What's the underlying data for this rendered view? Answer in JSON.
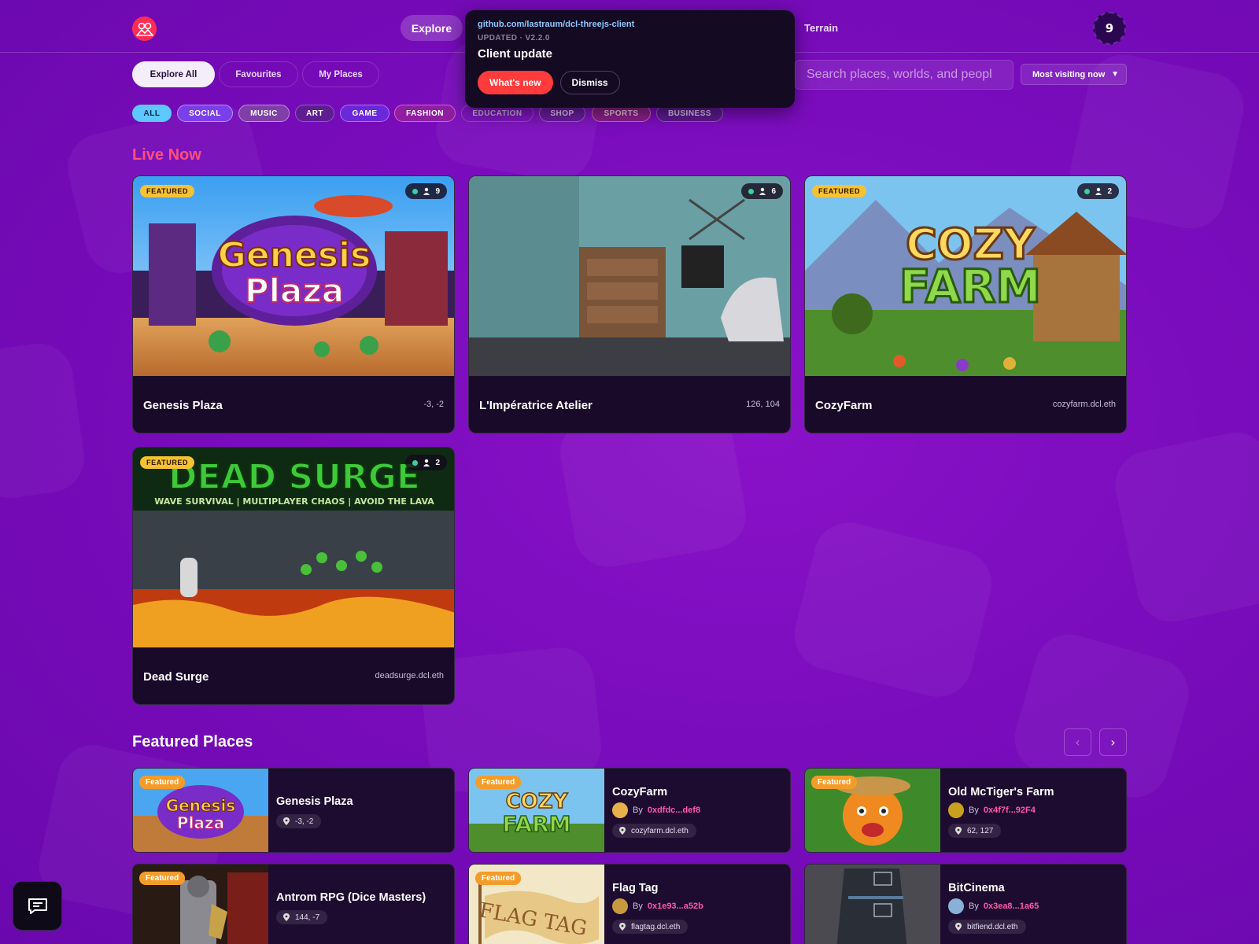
{
  "header": {
    "nav_explore": "Explore",
    "nav_terrain": "Terrain",
    "user_badge": "9"
  },
  "popup": {
    "url": "github.com/lastraum/dcl-threejs-client",
    "version": "UPDATED · V2.2.0",
    "title": "Client update",
    "primary_button": "What's new",
    "secondary_button": "Dismiss"
  },
  "filters": {
    "tabs": [
      "Explore All",
      "Favourites",
      "My Places"
    ],
    "search_placeholder": "Search places, worlds, and peopl",
    "sort_value": "Most visiting now"
  },
  "categories": [
    "ALL",
    "SOCIAL",
    "MUSIC",
    "ART",
    "GAME",
    "FASHION",
    "EDUCATION",
    "SHOP",
    "SPORTS",
    "BUSINESS"
  ],
  "live": {
    "title": "Live Now",
    "featured_label": "FEATURED",
    "cards": [
      {
        "name": "Genesis Plaza",
        "location": "-3, -2",
        "users": "9",
        "featured": true
      },
      {
        "name": "L'Impératrice Atelier",
        "location": "126, 104",
        "users": "6",
        "featured": false
      },
      {
        "name": "CozyFarm",
        "location": "cozyfarm.dcl.eth",
        "users": "2",
        "featured": true
      },
      {
        "name": "Dead Surge",
        "location": "deadsurge.dcl.eth",
        "users": "2",
        "featured": true
      }
    ]
  },
  "featured": {
    "title": "Featured Places",
    "badge_label": "Featured",
    "by_label": "By",
    "prev_icon": "chevron-left-icon",
    "next_icon": "chevron-right-icon",
    "cards": [
      {
        "title": "Genesis Plaza",
        "author": "",
        "location": "-3, -2"
      },
      {
        "title": "CozyFarm",
        "author": "0xdfdc...def8",
        "location": "cozyfarm.dcl.eth"
      },
      {
        "title": "Old McTiger's Farm",
        "author": "0x4f7f...92F4",
        "location": "62, 127"
      },
      {
        "title": "Antrom RPG (Dice Masters)",
        "author": "",
        "location": "144, -7"
      },
      {
        "title": "Flag Tag",
        "author": "0x1e93...a52b",
        "location": "flagtag.dcl.eth"
      },
      {
        "title": "BitCinema",
        "author": "0x3ea8...1a65",
        "location": "bitfiend.dcl.eth"
      }
    ]
  },
  "colors": {
    "accent": "#ff2d55",
    "live_title": "#ff4f7b",
    "featured_badge": "#f6c233",
    "author_link": "#ff5ba8"
  },
  "icons": {
    "logo": "decentraland-logo-icon",
    "chat": "chat-icon",
    "users": "user-icon",
    "location": "pin-icon"
  }
}
